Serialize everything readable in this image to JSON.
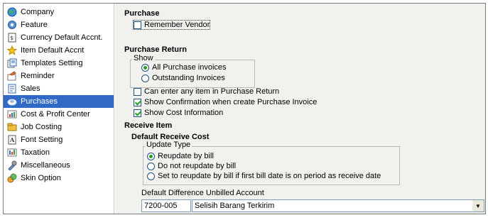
{
  "sidebar": {
    "items": [
      {
        "label": "Company",
        "icon": "globe-icon"
      },
      {
        "label": "Feature",
        "icon": "gear-icon"
      },
      {
        "label": "Currency Default Accnt.",
        "icon": "currency-icon"
      },
      {
        "label": "Item Default Accnt",
        "icon": "star-icon"
      },
      {
        "label": "Templates Setting",
        "icon": "templates-icon"
      },
      {
        "label": "Reminder",
        "icon": "reminder-icon"
      },
      {
        "label": "Sales",
        "icon": "sales-icon"
      },
      {
        "label": "Purchases",
        "icon": "purchases-icon",
        "selected": true
      },
      {
        "label": "Cost & Profit Center",
        "icon": "cost-center-icon"
      },
      {
        "label": "Job Costing",
        "icon": "job-costing-icon"
      },
      {
        "label": "Font Setting",
        "icon": "font-icon"
      },
      {
        "label": "Taxation",
        "icon": "taxation-icon"
      },
      {
        "label": "Miscellaneous",
        "icon": "miscellaneous-icon"
      },
      {
        "label": "Skin Option",
        "icon": "skin-icon"
      }
    ]
  },
  "purchase": {
    "title": "Purchase",
    "remember_vendor": {
      "label": "Remember Vendor",
      "checked": false
    }
  },
  "purchase_return": {
    "title": "Purchase Return",
    "show_group": {
      "legend": "Show",
      "options": [
        {
          "label": "All Purchase invoices",
          "selected": true
        },
        {
          "label": "Outstanding Invoices",
          "selected": false
        }
      ]
    },
    "checks": [
      {
        "label": "Can enter any item in Purchase Return",
        "checked": false
      },
      {
        "label": "Show Confirmation when create Purchase Invoice",
        "checked": true
      },
      {
        "label": "Show Cost Information",
        "checked": true
      }
    ]
  },
  "receive_item": {
    "title": "Receive Item",
    "default_cost_title": "Default Receive Cost",
    "update_type": {
      "legend": "Update Type",
      "options": [
        {
          "label": "Reupdate by bill",
          "selected": true
        },
        {
          "label": "Do not reupdate by bill",
          "selected": false
        },
        {
          "label": "Set to reupdate by bill if first bill date is on period as receive date",
          "selected": false
        }
      ]
    },
    "unbilled_account": {
      "label": "Default Difference Unbilled Account",
      "code": "7200-005",
      "name": "Selisih Barang Terkirim"
    }
  },
  "colors": {
    "selection": "#316ac5",
    "panel_bg": "#f1f1ed",
    "check_mark": "#21a121"
  }
}
